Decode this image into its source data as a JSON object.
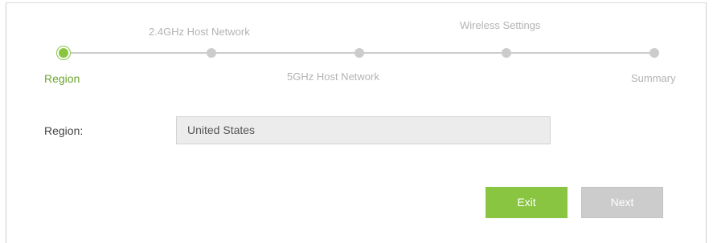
{
  "wizard": {
    "steps": [
      {
        "label": "Region",
        "state": "active"
      },
      {
        "label": "2.4GHz Host Network",
        "state": "pending"
      },
      {
        "label": "5GHz Host Network",
        "state": "pending"
      },
      {
        "label": "Wireless Settings",
        "state": "pending"
      },
      {
        "label": "Summary",
        "state": "pending"
      }
    ],
    "accent_color": "#8ac542",
    "inactive_color": "#cccccc"
  },
  "form": {
    "region_label": "Region:",
    "region_value": "United States"
  },
  "buttons": {
    "exit_label": "Exit",
    "next_label": "Next"
  }
}
